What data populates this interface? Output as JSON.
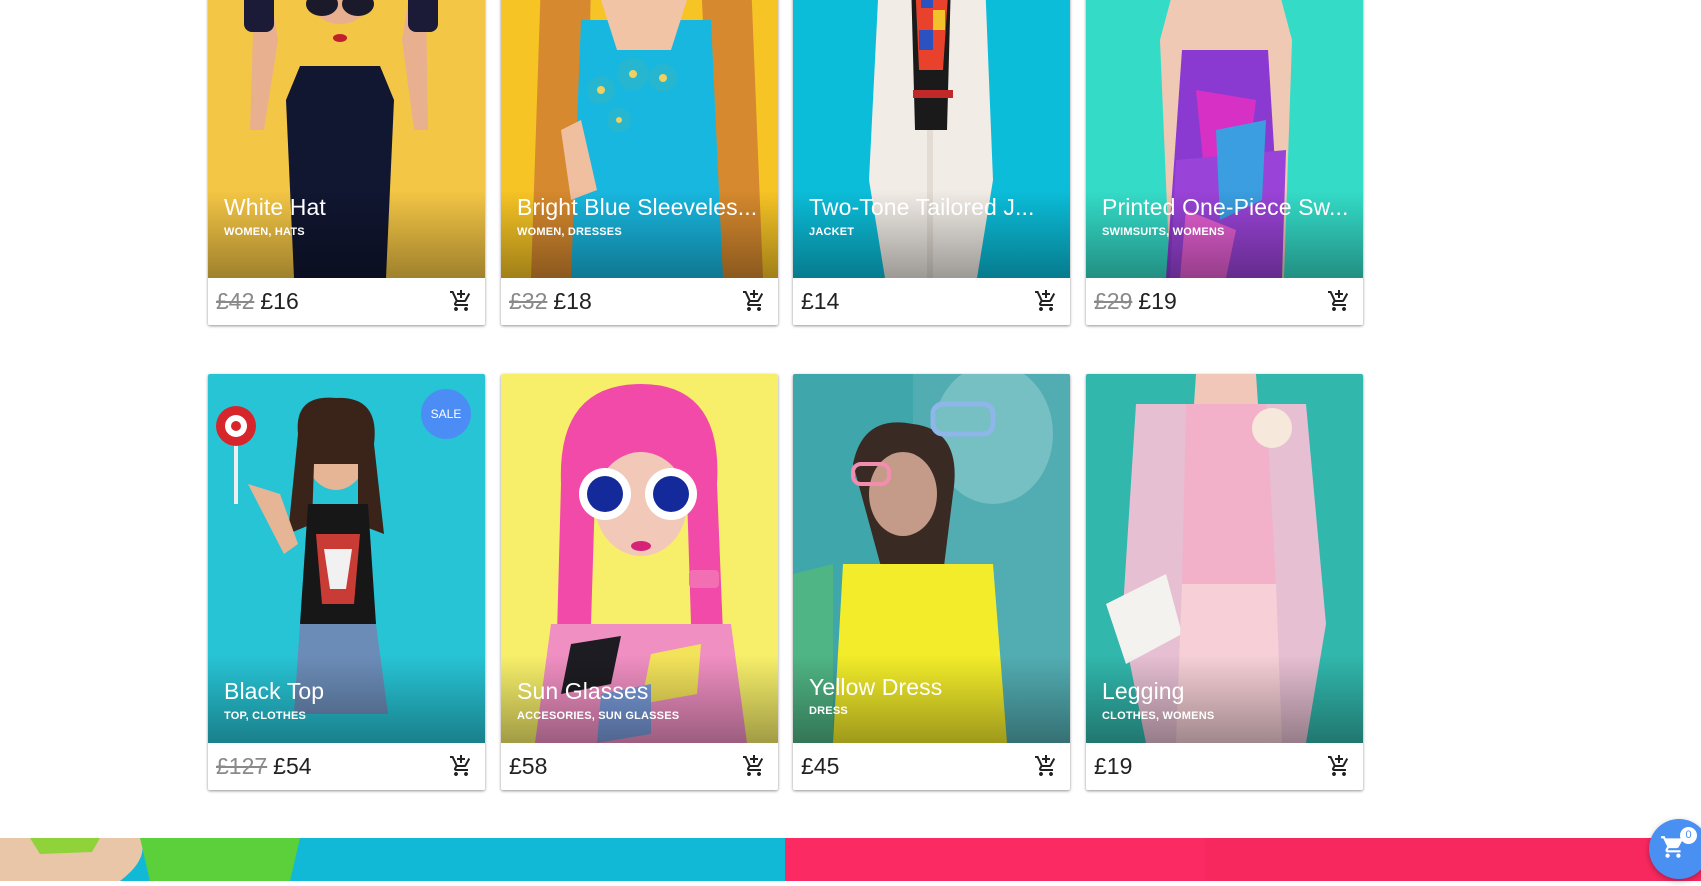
{
  "products": [
    {
      "title": "White Hat",
      "categories": "WOMEN, HATS",
      "old_price": "£42",
      "price": "£16"
    },
    {
      "title": "Bright Blue Sleeveles...",
      "categories": "WOMEN, DRESSES",
      "old_price": "£32",
      "price": "£18"
    },
    {
      "title": "Two-Tone Tailored J...",
      "categories": "JACKET",
      "price": "£14"
    },
    {
      "title": "Printed One-Piece Sw...",
      "categories": "SWIMSUITS, WOMENS",
      "old_price": "£29",
      "price": "£19"
    },
    {
      "title": "Black Top",
      "categories": "TOP, CLOTHES",
      "old_price": "£127",
      "price": "£54",
      "badge": "SALE"
    },
    {
      "title": "Sun Glasses",
      "categories": "ACCESORIES, SUN GLASSES",
      "price": "£58"
    },
    {
      "title": "Yellow Dress",
      "categories": "DRESS",
      "price": "£45"
    },
    {
      "title": "Legging",
      "categories": "CLOTHES, WOMENS",
      "price": "£19"
    }
  ],
  "cart": {
    "count": "0"
  },
  "icons": {
    "add_to_cart": "add-shopping-cart-icon",
    "cart": "shopping-cart-icon"
  },
  "colors": {
    "accent": "#4a8ff2",
    "banner_cyan": "#11b9d6",
    "banner_pink": "#fb2a63"
  }
}
